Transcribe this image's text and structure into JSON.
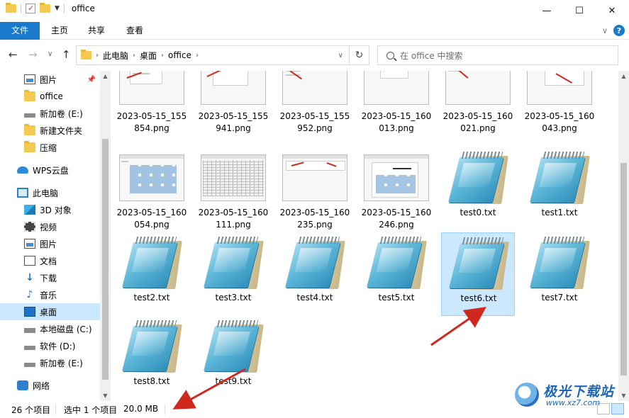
{
  "window": {
    "title": "office",
    "minimize": "—",
    "maximize": "☐",
    "close": "✕"
  },
  "ribbon": {
    "tabs": [
      {
        "label": "文件",
        "active": true
      },
      {
        "label": "主页"
      },
      {
        "label": "共享"
      },
      {
        "label": "查看"
      }
    ],
    "collapse": "∨",
    "help": "?"
  },
  "address": {
    "back": "←",
    "forward": "→",
    "recent": "∨",
    "up": "↑",
    "crumbs": [
      "此电脑",
      "桌面",
      "office"
    ],
    "separator": "›",
    "refresh": "↻",
    "search_placeholder": "在 office 中搜索"
  },
  "nav": {
    "quick_access": [
      {
        "label": "图片",
        "icon": "image-icon",
        "pinned": true
      },
      {
        "label": "office",
        "icon": "folder-icon"
      },
      {
        "label": "新加卷 (E:)",
        "icon": "drive-icon"
      },
      {
        "label": "新建文件夹",
        "icon": "folder-icon"
      },
      {
        "label": "压缩",
        "icon": "folder-icon"
      }
    ],
    "wps": {
      "label": "WPS云盘",
      "icon": "cloud-icon"
    },
    "this_pc": {
      "label": "此电脑",
      "icon": "computer-icon"
    },
    "pc_items": [
      {
        "label": "3D 对象",
        "icon": "3d-objects-icon"
      },
      {
        "label": "视频",
        "icon": "video-icon"
      },
      {
        "label": "图片",
        "icon": "image-icon"
      },
      {
        "label": "文档",
        "icon": "document-icon"
      },
      {
        "label": "下载",
        "icon": "download-icon"
      },
      {
        "label": "音乐",
        "icon": "music-icon"
      },
      {
        "label": "桌面",
        "icon": "desktop-icon",
        "selected": true
      },
      {
        "label": "本地磁盘 (C:)",
        "icon": "local-disk-icon"
      },
      {
        "label": "软件 (D:)",
        "icon": "drive-icon"
      },
      {
        "label": "新加卷 (E:)",
        "icon": "drive-icon"
      }
    ],
    "network": {
      "label": "网络",
      "icon": "network-icon"
    },
    "pin_icon": "📌"
  },
  "files": [
    {
      "name": "2023-05-15_155\n854.png",
      "type": "png"
    },
    {
      "name": "2023-05-15_155\n941.png",
      "type": "png"
    },
    {
      "name": "2023-05-15_155\n952.png",
      "type": "png"
    },
    {
      "name": "2023-05-15_160\n013.png",
      "type": "png"
    },
    {
      "name": "2023-05-15_160\n021.png",
      "type": "png"
    },
    {
      "name": "2023-05-15_160\n043.png",
      "type": "png"
    },
    {
      "name": "2023-05-15_160\n054.png",
      "type": "png"
    },
    {
      "name": "2023-05-15_160\n111.png",
      "type": "png"
    },
    {
      "name": "2023-05-15_160\n235.png",
      "type": "png"
    },
    {
      "name": "2023-05-15_160\n246.png",
      "type": "png"
    },
    {
      "name": "test0.txt",
      "type": "txt"
    },
    {
      "name": "test1.txt",
      "type": "txt"
    },
    {
      "name": "test2.txt",
      "type": "txt"
    },
    {
      "name": "test3.txt",
      "type": "txt"
    },
    {
      "name": "test4.txt",
      "type": "txt"
    },
    {
      "name": "test5.txt",
      "type": "txt"
    },
    {
      "name": "test6.txt",
      "type": "txt",
      "selected": true
    },
    {
      "name": "test7.txt",
      "type": "txt"
    },
    {
      "name": "test8.txt",
      "type": "txt"
    },
    {
      "name": "test9.txt",
      "type": "txt"
    }
  ],
  "status": {
    "count": "26 个项目",
    "selection": "选中 1 个项目",
    "size": "20.0 MB"
  },
  "watermark": {
    "title": "极光下载站",
    "url": "www.xz7.com"
  },
  "colors": {
    "accent": "#1979ca",
    "selection": "#cce8ff",
    "arrow": "#d0281e"
  }
}
